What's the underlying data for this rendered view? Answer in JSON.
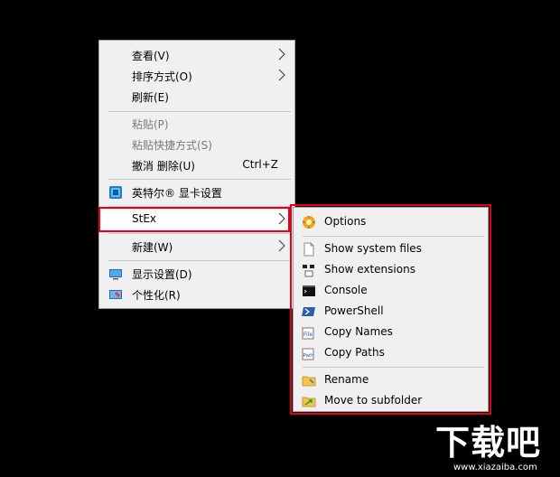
{
  "context_menu": {
    "items": [
      {
        "label": "查看(V)"
      },
      {
        "label": "排序方式(O)"
      },
      {
        "label": "刷新(E)"
      },
      {
        "label": "粘贴(P)"
      },
      {
        "label": "粘贴快捷方式(S)"
      },
      {
        "label": "撤消 删除(U)",
        "shortcut": "Ctrl+Z"
      },
      {
        "label": "英特尔® 显卡设置"
      },
      {
        "label": "StEx"
      },
      {
        "label": "新建(W)"
      },
      {
        "label": "显示设置(D)"
      },
      {
        "label": "个性化(R)"
      }
    ]
  },
  "stex_submenu": {
    "items": [
      {
        "label": "Options"
      },
      {
        "label": "Show system files"
      },
      {
        "label": "Show extensions"
      },
      {
        "label": "Console"
      },
      {
        "label": "PowerShell"
      },
      {
        "label": "Copy Names"
      },
      {
        "label": "Copy Paths"
      },
      {
        "label": "Rename"
      },
      {
        "label": "Move to subfolder"
      }
    ]
  },
  "watermark": {
    "logo": "下载吧",
    "url": "www.xiazaiba.com"
  },
  "colors": {
    "highlight_border": "#e4001b",
    "menu_background": "#f0f0f0",
    "desktop": "#000000"
  }
}
